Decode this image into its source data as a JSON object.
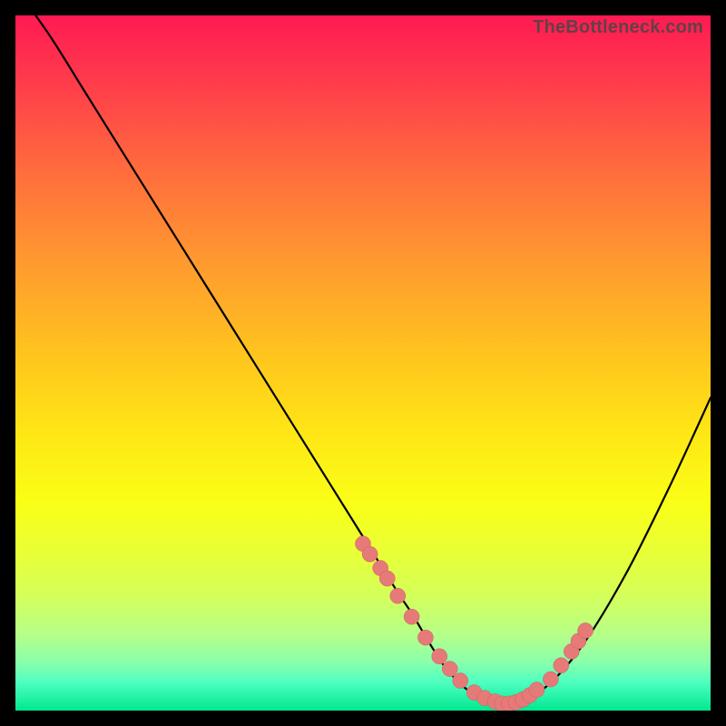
{
  "watermark": "TheBottleneck.com",
  "colors": {
    "dot_fill": "#e67a78",
    "dot_stroke": "#cc5f5f",
    "curve": "#000000"
  },
  "chart_data": {
    "type": "line",
    "title": "",
    "xlabel": "",
    "ylabel": "",
    "xlim": [
      0,
      100
    ],
    "ylim": [
      0,
      100
    ],
    "series": [
      {
        "name": "bottleneck-curve",
        "x": [
          0,
          5,
          10,
          15,
          20,
          25,
          30,
          35,
          40,
          45,
          50,
          55,
          57,
          60,
          62,
          65,
          68,
          70,
          73,
          77,
          82,
          88,
          94,
          100
        ],
        "y": [
          104,
          97,
          89,
          81,
          73,
          65,
          57,
          49,
          41,
          33,
          25,
          17,
          14,
          9,
          6,
          3,
          1.5,
          1,
          1.5,
          4,
          10,
          20,
          32,
          45
        ]
      }
    ],
    "highlight_points": {
      "name": "scatter-dots",
      "x": [
        50,
        51,
        52.5,
        53.5,
        55,
        57,
        59,
        61,
        62.5,
        64,
        66,
        67.5,
        69,
        70,
        71,
        72,
        73,
        74,
        75,
        77,
        78.5,
        80,
        81,
        82
      ],
      "y": [
        24,
        22.5,
        20.5,
        19,
        16.5,
        13.5,
        10.5,
        7.8,
        6,
        4.3,
        2.6,
        1.8,
        1.3,
        1,
        1,
        1.2,
        1.6,
        2.2,
        3,
        4.5,
        6.5,
        8.5,
        10,
        11.5
      ]
    }
  }
}
